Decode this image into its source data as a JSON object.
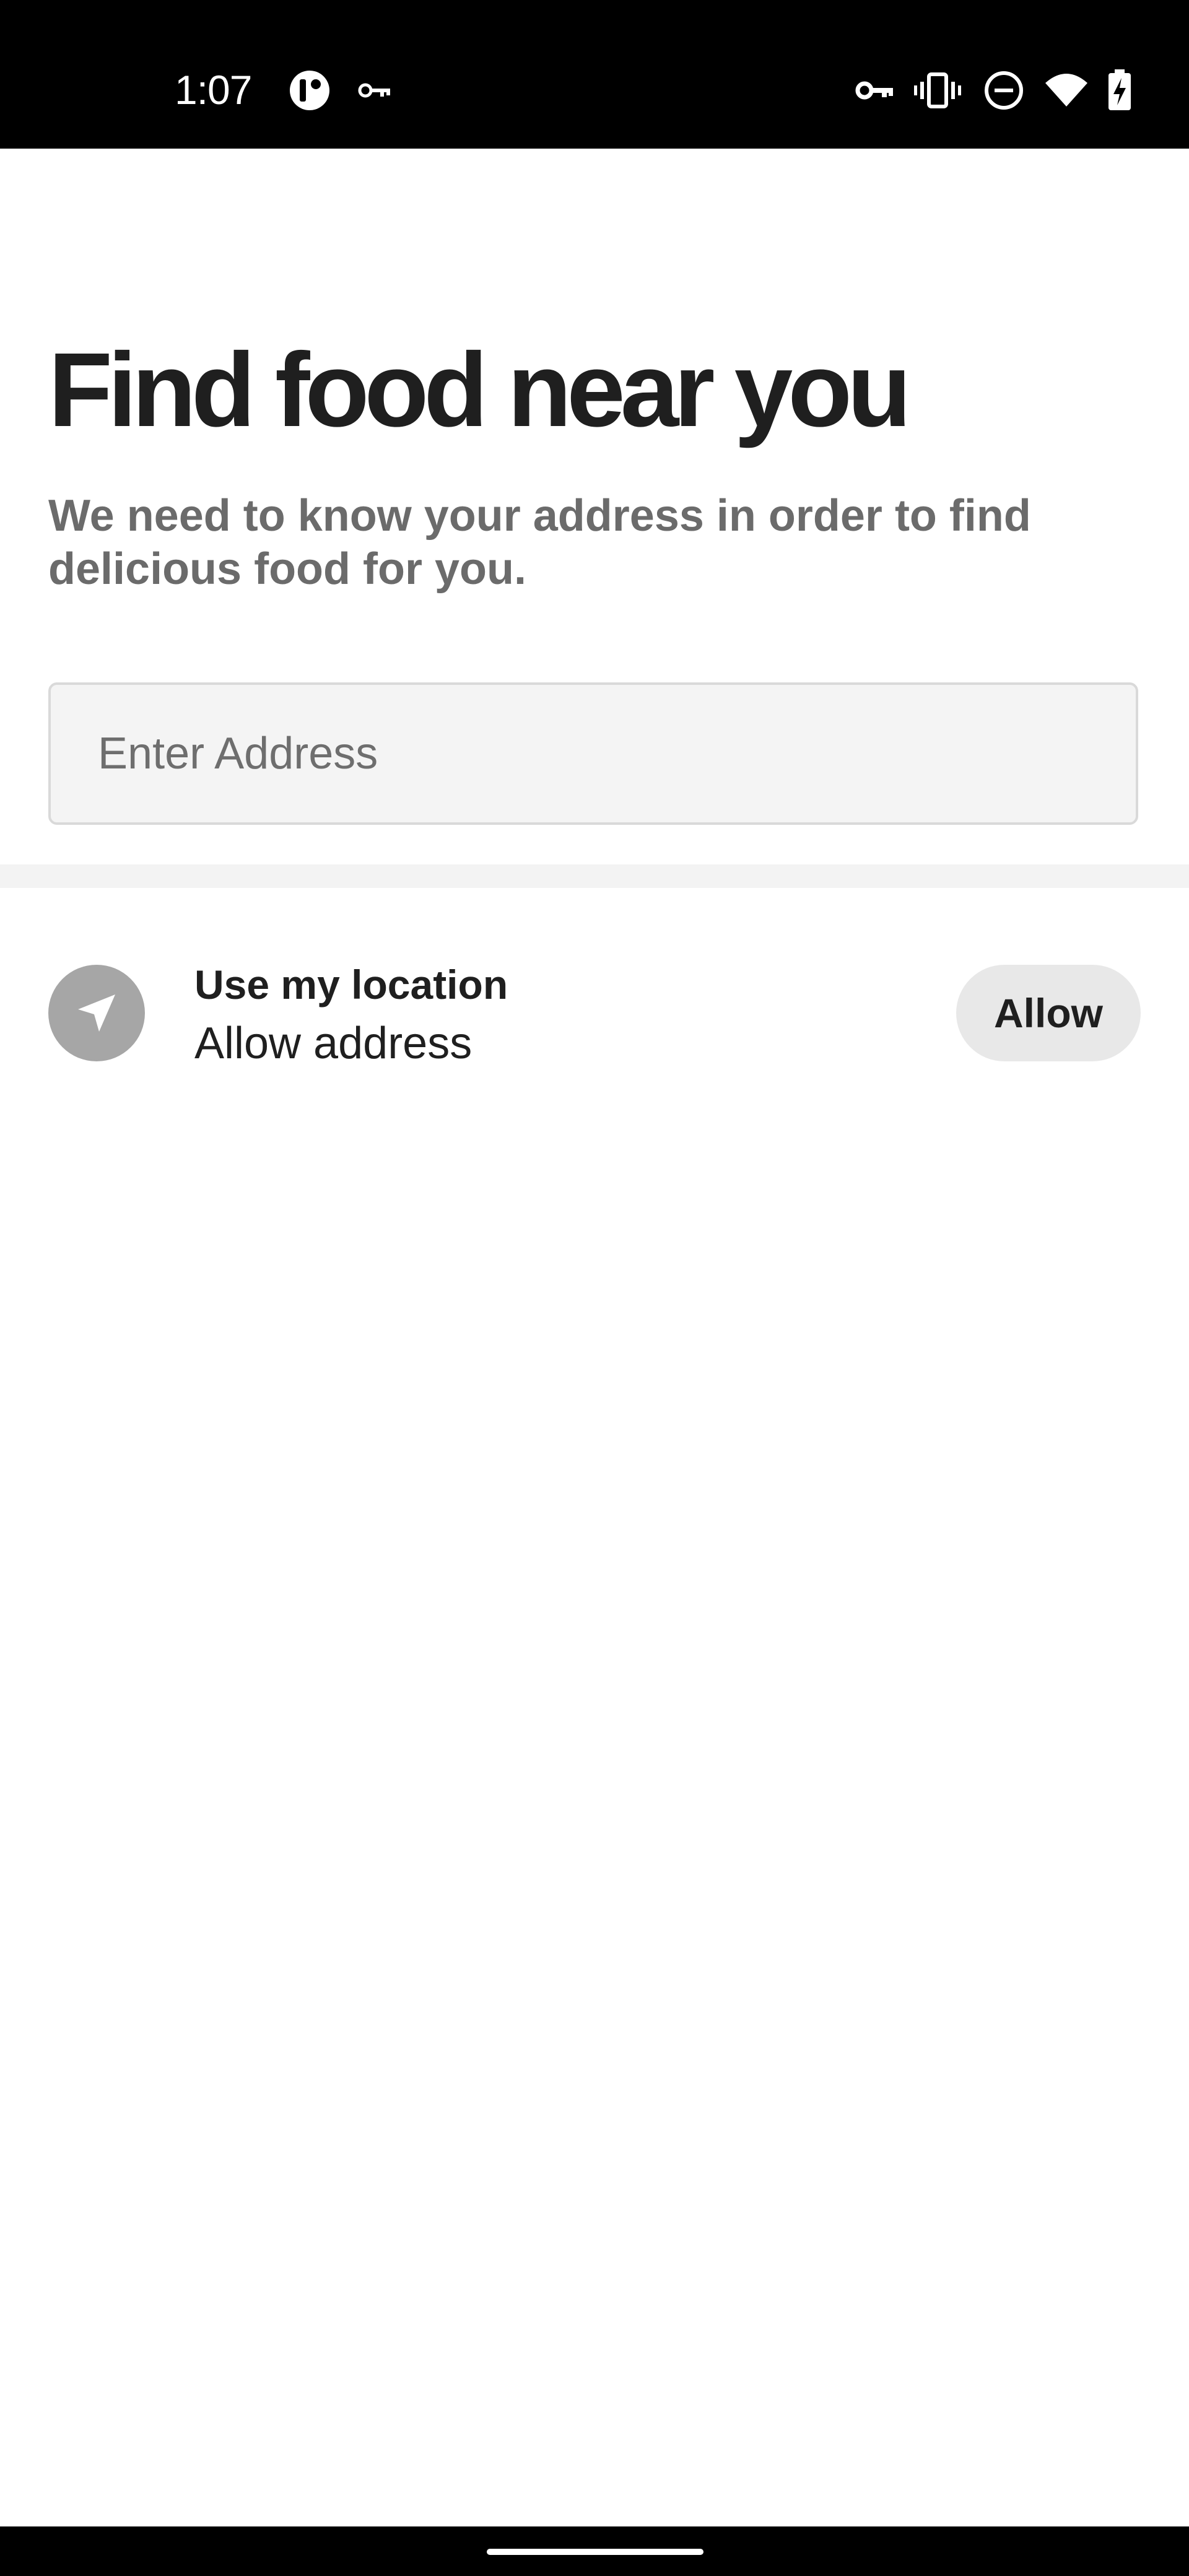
{
  "status_bar": {
    "time": "1:07",
    "icons": [
      "app-notification-icon",
      "vpn-key-icon",
      "vpn-key-icon",
      "vibrate-icon",
      "do-not-disturb-icon",
      "wifi-icon",
      "battery-charging-icon"
    ]
  },
  "main": {
    "title": "Find food near you",
    "subtitle": "We need to know your address in order to find delicious food for you.",
    "address_input": {
      "value": "",
      "placeholder": "Enter Address"
    },
    "location": {
      "icon": "navigation-arrow-icon",
      "title": "Use my location",
      "subtitle": "Allow address",
      "button_label": "Allow"
    }
  },
  "colors": {
    "status_bar_bg": "#000000",
    "title": "#1f1f1f",
    "subtitle": "#6b6b6b",
    "input_bg": "#f4f4f4",
    "icon_circle": "#a6a6a6",
    "button_bg": "#e8e8e8"
  }
}
